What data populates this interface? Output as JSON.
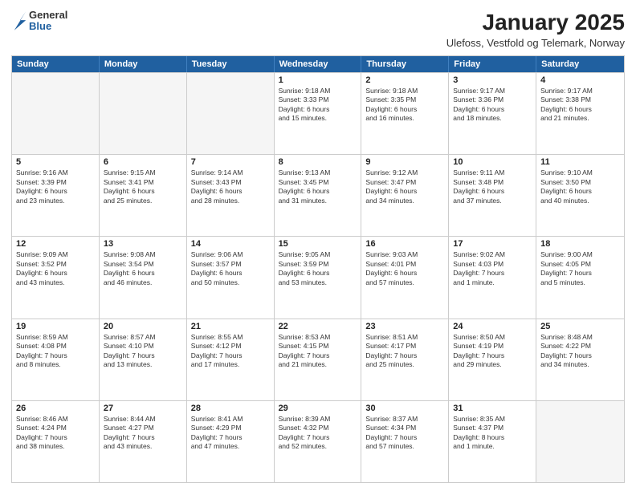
{
  "logo": {
    "general": "General",
    "blue": "Blue"
  },
  "title": "January 2025",
  "subtitle": "Ulefoss, Vestfold og Telemark, Norway",
  "days": [
    "Sunday",
    "Monday",
    "Tuesday",
    "Wednesday",
    "Thursday",
    "Friday",
    "Saturday"
  ],
  "weeks": [
    [
      {
        "day": "",
        "info": ""
      },
      {
        "day": "",
        "info": ""
      },
      {
        "day": "",
        "info": ""
      },
      {
        "day": "1",
        "info": "Sunrise: 9:18 AM\nSunset: 3:33 PM\nDaylight: 6 hours\nand 15 minutes."
      },
      {
        "day": "2",
        "info": "Sunrise: 9:18 AM\nSunset: 3:35 PM\nDaylight: 6 hours\nand 16 minutes."
      },
      {
        "day": "3",
        "info": "Sunrise: 9:17 AM\nSunset: 3:36 PM\nDaylight: 6 hours\nand 18 minutes."
      },
      {
        "day": "4",
        "info": "Sunrise: 9:17 AM\nSunset: 3:38 PM\nDaylight: 6 hours\nand 21 minutes."
      }
    ],
    [
      {
        "day": "5",
        "info": "Sunrise: 9:16 AM\nSunset: 3:39 PM\nDaylight: 6 hours\nand 23 minutes."
      },
      {
        "day": "6",
        "info": "Sunrise: 9:15 AM\nSunset: 3:41 PM\nDaylight: 6 hours\nand 25 minutes."
      },
      {
        "day": "7",
        "info": "Sunrise: 9:14 AM\nSunset: 3:43 PM\nDaylight: 6 hours\nand 28 minutes."
      },
      {
        "day": "8",
        "info": "Sunrise: 9:13 AM\nSunset: 3:45 PM\nDaylight: 6 hours\nand 31 minutes."
      },
      {
        "day": "9",
        "info": "Sunrise: 9:12 AM\nSunset: 3:47 PM\nDaylight: 6 hours\nand 34 minutes."
      },
      {
        "day": "10",
        "info": "Sunrise: 9:11 AM\nSunset: 3:48 PM\nDaylight: 6 hours\nand 37 minutes."
      },
      {
        "day": "11",
        "info": "Sunrise: 9:10 AM\nSunset: 3:50 PM\nDaylight: 6 hours\nand 40 minutes."
      }
    ],
    [
      {
        "day": "12",
        "info": "Sunrise: 9:09 AM\nSunset: 3:52 PM\nDaylight: 6 hours\nand 43 minutes."
      },
      {
        "day": "13",
        "info": "Sunrise: 9:08 AM\nSunset: 3:54 PM\nDaylight: 6 hours\nand 46 minutes."
      },
      {
        "day": "14",
        "info": "Sunrise: 9:06 AM\nSunset: 3:57 PM\nDaylight: 6 hours\nand 50 minutes."
      },
      {
        "day": "15",
        "info": "Sunrise: 9:05 AM\nSunset: 3:59 PM\nDaylight: 6 hours\nand 53 minutes."
      },
      {
        "day": "16",
        "info": "Sunrise: 9:03 AM\nSunset: 4:01 PM\nDaylight: 6 hours\nand 57 minutes."
      },
      {
        "day": "17",
        "info": "Sunrise: 9:02 AM\nSunset: 4:03 PM\nDaylight: 7 hours\nand 1 minute."
      },
      {
        "day": "18",
        "info": "Sunrise: 9:00 AM\nSunset: 4:05 PM\nDaylight: 7 hours\nand 5 minutes."
      }
    ],
    [
      {
        "day": "19",
        "info": "Sunrise: 8:59 AM\nSunset: 4:08 PM\nDaylight: 7 hours\nand 8 minutes."
      },
      {
        "day": "20",
        "info": "Sunrise: 8:57 AM\nSunset: 4:10 PM\nDaylight: 7 hours\nand 13 minutes."
      },
      {
        "day": "21",
        "info": "Sunrise: 8:55 AM\nSunset: 4:12 PM\nDaylight: 7 hours\nand 17 minutes."
      },
      {
        "day": "22",
        "info": "Sunrise: 8:53 AM\nSunset: 4:15 PM\nDaylight: 7 hours\nand 21 minutes."
      },
      {
        "day": "23",
        "info": "Sunrise: 8:51 AM\nSunset: 4:17 PM\nDaylight: 7 hours\nand 25 minutes."
      },
      {
        "day": "24",
        "info": "Sunrise: 8:50 AM\nSunset: 4:19 PM\nDaylight: 7 hours\nand 29 minutes."
      },
      {
        "day": "25",
        "info": "Sunrise: 8:48 AM\nSunset: 4:22 PM\nDaylight: 7 hours\nand 34 minutes."
      }
    ],
    [
      {
        "day": "26",
        "info": "Sunrise: 8:46 AM\nSunset: 4:24 PM\nDaylight: 7 hours\nand 38 minutes."
      },
      {
        "day": "27",
        "info": "Sunrise: 8:44 AM\nSunset: 4:27 PM\nDaylight: 7 hours\nand 43 minutes."
      },
      {
        "day": "28",
        "info": "Sunrise: 8:41 AM\nSunset: 4:29 PM\nDaylight: 7 hours\nand 47 minutes."
      },
      {
        "day": "29",
        "info": "Sunrise: 8:39 AM\nSunset: 4:32 PM\nDaylight: 7 hours\nand 52 minutes."
      },
      {
        "day": "30",
        "info": "Sunrise: 8:37 AM\nSunset: 4:34 PM\nDaylight: 7 hours\nand 57 minutes."
      },
      {
        "day": "31",
        "info": "Sunrise: 8:35 AM\nSunset: 4:37 PM\nDaylight: 8 hours\nand 1 minute."
      },
      {
        "day": "",
        "info": ""
      }
    ]
  ]
}
